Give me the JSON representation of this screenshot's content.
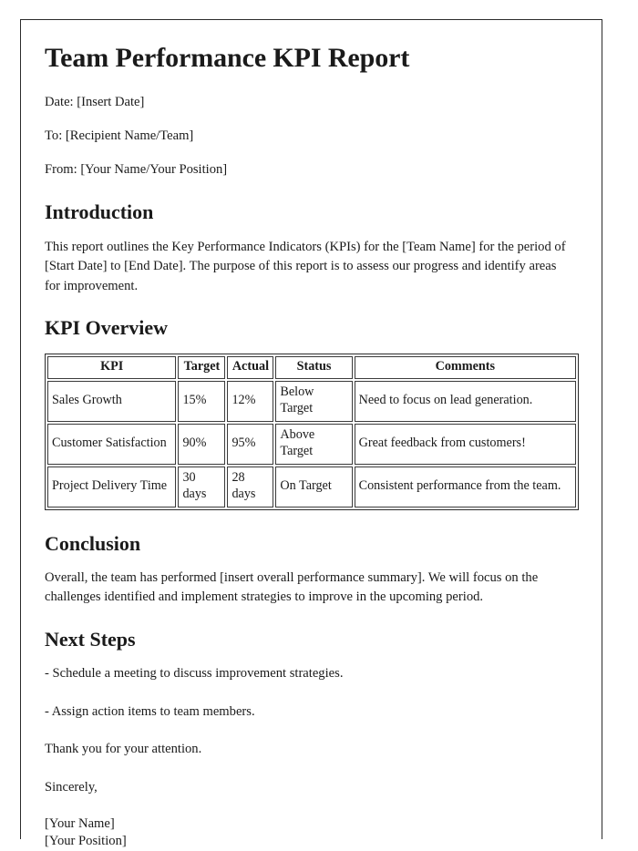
{
  "document": {
    "title": "Team Performance KPI Report",
    "meta": [
      {
        "name": "date-line",
        "text": "Date: [Insert Date]"
      },
      {
        "name": "to-line",
        "text": "To: [Recipient Name/Team]"
      },
      {
        "name": "from-line",
        "text": "From: [Your Name/Your Position]"
      }
    ],
    "introduction": {
      "heading": "Introduction",
      "paragraph": "This report outlines the Key Performance Indicators (KPIs) for the [Team Name] for the period of [Start Date] to [End Date]. The purpose of this report is to assess our progress and identify areas for improvement."
    },
    "kpi_overview": {
      "heading": "KPI Overview",
      "table": {
        "columns": [
          "KPI",
          "Target",
          "Actual",
          "Status",
          "Comments"
        ],
        "rows": [
          {
            "kpi": "Sales Growth",
            "target": "15%",
            "actual": "12%",
            "status": "Below Target",
            "comments": "Need to focus on lead generation."
          },
          {
            "kpi": "Customer Satisfaction",
            "target": "90%",
            "actual": "95%",
            "status": "Above Target",
            "comments": "Great feedback from customers!"
          },
          {
            "kpi": "Project Delivery Time",
            "target": "30 days",
            "actual": "28 days",
            "status": "On Target",
            "comments": "Consistent performance from the team."
          }
        ]
      }
    },
    "conclusion": {
      "heading": "Conclusion",
      "paragraph": "Overall, the team has performed [insert overall performance summary]. We will focus on the challenges identified and implement strategies to improve in the upcoming period."
    },
    "next_steps": {
      "heading": "Next Steps",
      "items": [
        "- Schedule a meeting to discuss improvement strategies.",
        "- Assign action items to team members."
      ],
      "thanks": "Thank you for your attention.",
      "closing": "Sincerely,",
      "signature_name": "[Your Name]",
      "signature_position": "[Your Position]"
    }
  },
  "colors": {
    "page_border": "#2b2b2b",
    "text": "#1a1a1a",
    "table_border": "#3a3a3a",
    "background": "#ffffff"
  }
}
